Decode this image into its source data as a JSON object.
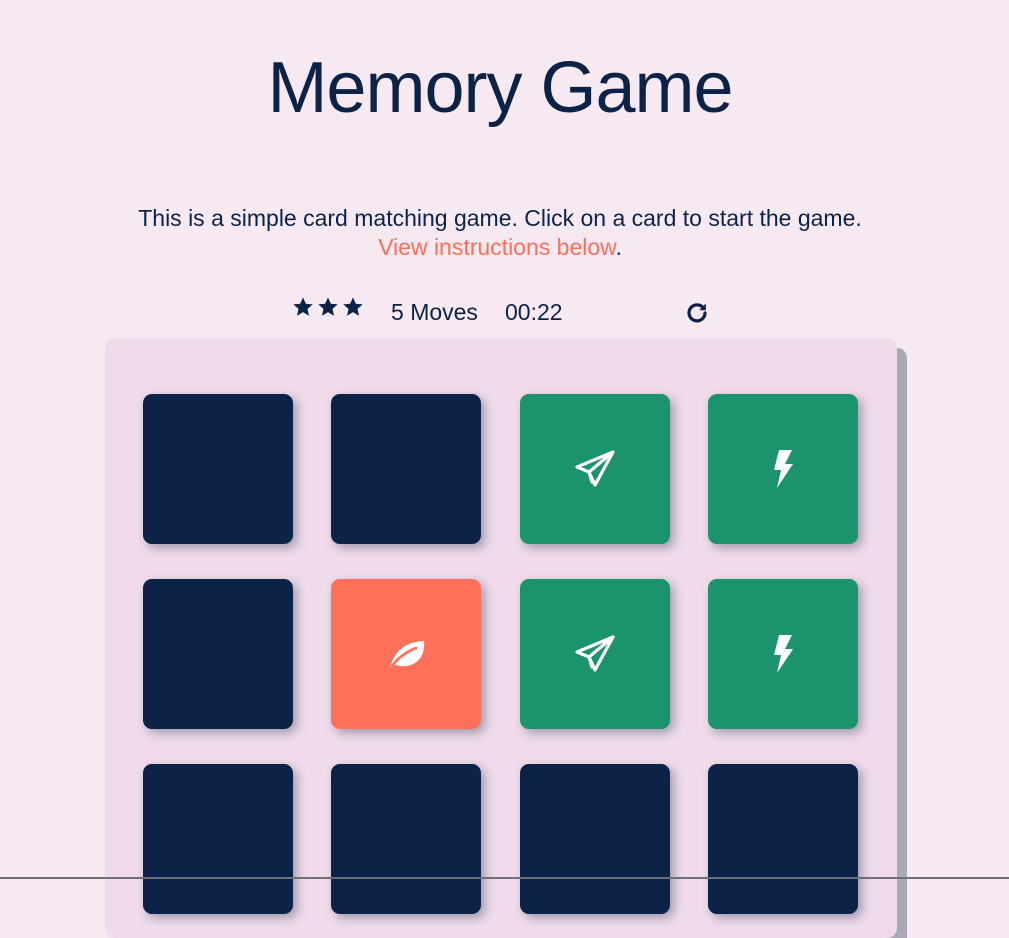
{
  "header": {
    "title": "Memory Game"
  },
  "intro": {
    "text": "This is a simple card matching game. Click on a card to start the game.",
    "link_text": "View instructions below",
    "trailing": "."
  },
  "score_panel": {
    "stars": 3,
    "moves": "5",
    "moves_label": "Moves",
    "timer": "00:22",
    "restart_icon": "restart-icon"
  },
  "colors": {
    "background": "#f7e9f2",
    "deck": "#efdbe9",
    "card_back": "#0c2347",
    "card_match": "#1b936c",
    "card_open": "#ff705a",
    "text": "#0c2347",
    "link": "#ff705a"
  },
  "deck": {
    "cards": [
      {
        "state": "closed",
        "icon": ""
      },
      {
        "state": "closed",
        "icon": ""
      },
      {
        "state": "match",
        "icon": "paper-plane-icon"
      },
      {
        "state": "match",
        "icon": "bolt-icon"
      },
      {
        "state": "closed",
        "icon": ""
      },
      {
        "state": "open",
        "icon": "leaf-icon"
      },
      {
        "state": "match",
        "icon": "paper-plane-icon"
      },
      {
        "state": "match",
        "icon": "bolt-icon"
      },
      {
        "state": "closed",
        "icon": ""
      },
      {
        "state": "closed",
        "icon": ""
      },
      {
        "state": "closed",
        "icon": ""
      },
      {
        "state": "closed",
        "icon": ""
      }
    ]
  }
}
